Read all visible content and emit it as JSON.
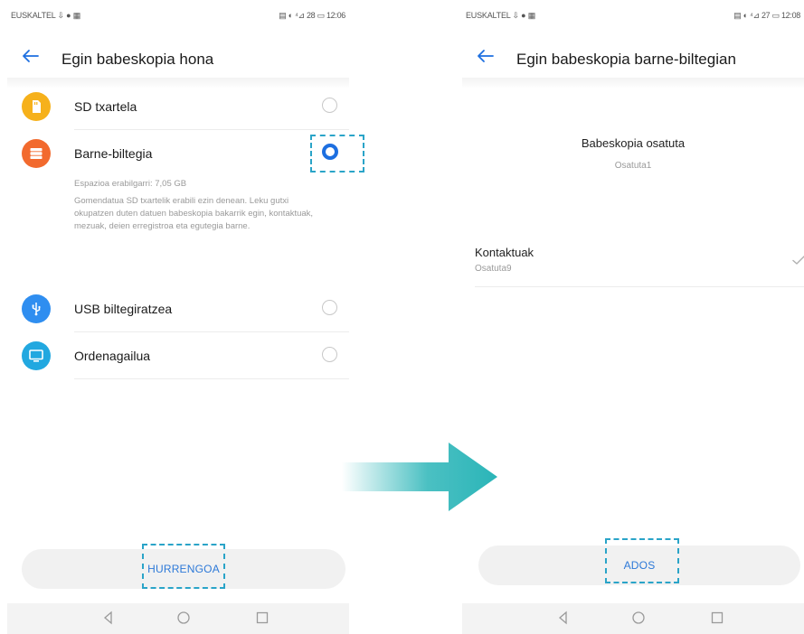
{
  "left_screen": {
    "status_bar": {
      "carrier": "EUSKALTEL ⇩ ● ▦",
      "right": "▤ ◐ ⁴⊿ 28 ▭ 12:06"
    },
    "header": {
      "title": "Egin babeskopia hona"
    },
    "options": [
      {
        "label": "SD txartela",
        "icon": "sd-card-icon",
        "color": "#f6b11b",
        "selected": false
      },
      {
        "label": "Barne-biltegia",
        "icon": "storage-icon",
        "color": "#f26a2e",
        "selected": true
      },
      {
        "label": "USB biltegiratzea",
        "icon": "usb-icon",
        "color": "#2f8ef0",
        "selected": false
      },
      {
        "label": "Ordenagailua",
        "icon": "computer-icon",
        "color": "#22a8e0",
        "selected": false
      }
    ],
    "description": {
      "space": "Espazioa erabilgarri: 7,05 GB",
      "text": "Gomendatua SD txartelik erabili ezin denean. Leku gutxi okupatzen duten datuen babeskopia bakarrik egin, kontaktuak, mezuak, deien erregistroa eta egutegia barne."
    },
    "next_button": "HURRENGOA"
  },
  "right_screen": {
    "status_bar": {
      "carrier": "EUSKALTEL ⇩ ● ▦",
      "right": "▤ ◐ ⁴⊿ 27 ▭ 12:08"
    },
    "header": {
      "title": "Egin babeskopia barne-biltegian"
    },
    "status_title": "Babeskopia osatuta",
    "status_sub": "Osatuta1",
    "item": {
      "title": "Kontaktuak",
      "sub": "Osatuta9"
    },
    "done_button": "ADOS"
  },
  "colors": {
    "accent": "#1d6fe0",
    "link": "#2d79d8",
    "highlight_dash": "#2aa4c8",
    "flow_arrow": "#2bb5b8"
  }
}
